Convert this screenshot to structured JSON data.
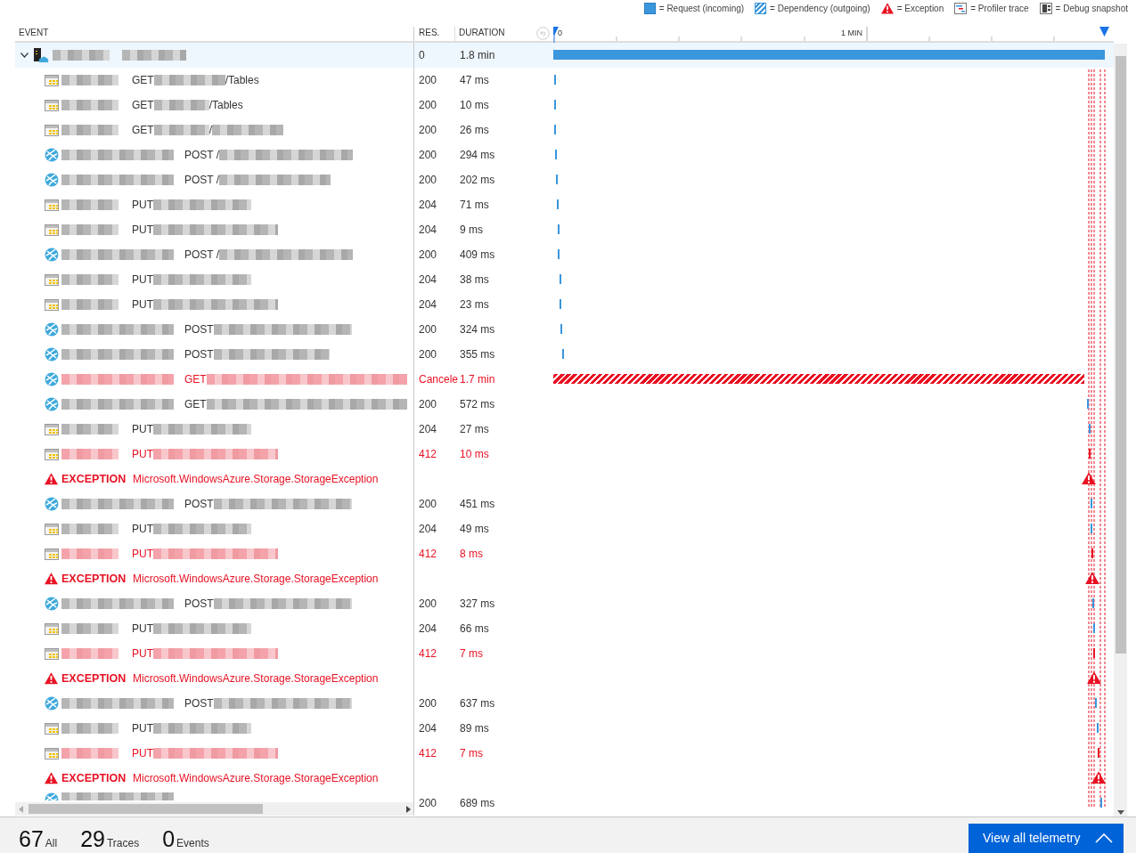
{
  "legend": [
    {
      "kind": "request",
      "label": "= Request (incoming)"
    },
    {
      "kind": "dependency",
      "label": "= Dependency (outgoing)"
    },
    {
      "kind": "exception",
      "label": "= Exception"
    },
    {
      "kind": "profiler",
      "label": "= Profiler trace"
    },
    {
      "kind": "snapshot",
      "label": "= Debug snapshot"
    }
  ],
  "columns": [
    "EVENT",
    "RES.",
    "DURATION"
  ],
  "timeline": {
    "start_label": "0",
    "mid_label": "1 MIN"
  },
  "rows": [
    {
      "kind": "root",
      "expanded": true,
      "selected": true,
      "res": "0",
      "duration": "1.8 min"
    },
    {
      "kind": "table",
      "selected": false,
      "failed": false,
      "method": "GET",
      "path": "/Tables",
      "res": "200",
      "duration": "47 ms"
    },
    {
      "kind": "table",
      "selected": false,
      "failed": false,
      "method": "GET",
      "path": "/Tables",
      "res": "200",
      "duration": "10 ms"
    },
    {
      "kind": "table",
      "selected": false,
      "failed": false,
      "method": "GET",
      "path": "/",
      "res": "200",
      "duration": "26 ms"
    },
    {
      "kind": "web",
      "selected": false,
      "failed": false,
      "method": "POST /",
      "res": "200",
      "duration": "294 ms"
    },
    {
      "kind": "web",
      "selected": false,
      "failed": false,
      "method": "POST /",
      "res": "200",
      "duration": "202 ms"
    },
    {
      "kind": "table",
      "selected": false,
      "failed": false,
      "method": "PUT",
      "res": "204",
      "duration": "71 ms"
    },
    {
      "kind": "table",
      "selected": false,
      "failed": false,
      "method": "PUT",
      "res": "204",
      "duration": "9 ms"
    },
    {
      "kind": "web",
      "selected": false,
      "failed": false,
      "method": "POST /",
      "res": "200",
      "duration": "409 ms"
    },
    {
      "kind": "table",
      "selected": false,
      "failed": false,
      "method": "PUT",
      "res": "204",
      "duration": "38 ms"
    },
    {
      "kind": "table",
      "selected": false,
      "failed": false,
      "method": "PUT",
      "res": "204",
      "duration": "23 ms"
    },
    {
      "kind": "web",
      "selected": false,
      "failed": false,
      "method": "POST",
      "res": "200",
      "duration": "324 ms"
    },
    {
      "kind": "web",
      "selected": false,
      "failed": false,
      "method": "POST",
      "res": "200",
      "duration": "355 ms"
    },
    {
      "kind": "web",
      "selected": false,
      "failed": true,
      "method": "GET",
      "res": "Cancele",
      "duration": "1.7 min",
      "level": 0.963
    },
    {
      "kind": "web",
      "selected": false,
      "failed": false,
      "method": "GET",
      "res": "200",
      "duration": "572 ms"
    },
    {
      "kind": "table",
      "selected": false,
      "failed": false,
      "method": "PUT",
      "res": "204",
      "duration": "27 ms"
    },
    {
      "kind": "table",
      "selected": false,
      "failed": true,
      "method": "PUT",
      "res": "412",
      "duration": "10 ms"
    },
    {
      "kind": "exception",
      "selected": false,
      "label": "EXCEPTION",
      "message": "Microsoft.WindowsAzure.Storage.StorageException"
    },
    {
      "kind": "web",
      "selected": false,
      "failed": false,
      "method": "POST",
      "res": "200",
      "duration": "451 ms"
    },
    {
      "kind": "table",
      "selected": false,
      "failed": false,
      "method": "PUT",
      "res": "204",
      "duration": "49 ms"
    },
    {
      "kind": "table",
      "selected": false,
      "failed": true,
      "method": "PUT",
      "res": "412",
      "duration": "8 ms"
    },
    {
      "kind": "exception",
      "selected": false,
      "label": "EXCEPTION",
      "message": "Microsoft.WindowsAzure.Storage.StorageException"
    },
    {
      "kind": "web",
      "selected": false,
      "failed": false,
      "method": "POST",
      "res": "200",
      "duration": "327 ms"
    },
    {
      "kind": "table",
      "selected": false,
      "failed": false,
      "method": "PUT",
      "res": "204",
      "duration": "66 ms"
    },
    {
      "kind": "table",
      "selected": false,
      "failed": true,
      "method": "PUT",
      "res": "412",
      "duration": "7 ms"
    },
    {
      "kind": "exception",
      "selected": false,
      "label": "EXCEPTION",
      "message": "Microsoft.WindowsAzure.Storage.StorageException"
    },
    {
      "kind": "web",
      "selected": false,
      "failed": false,
      "method": "POST",
      "res": "200",
      "duration": "637 ms"
    },
    {
      "kind": "table",
      "selected": false,
      "failed": false,
      "method": "PUT",
      "res": "204",
      "duration": "89 ms"
    },
    {
      "kind": "table",
      "selected": false,
      "failed": true,
      "method": "PUT",
      "res": "412",
      "duration": "7 ms"
    },
    {
      "kind": "exception",
      "selected": false,
      "label": "EXCEPTION",
      "message": "Microsoft.WindowsAzure.Storage.StorageException"
    },
    {
      "kind": "web",
      "selected": false,
      "failed": false,
      "res": "200",
      "duration": "689 ms"
    }
  ],
  "footer": {
    "counts": [
      {
        "value": "67",
        "label": "All"
      },
      {
        "value": "29",
        "label": "Traces"
      },
      {
        "value": "0",
        "label": "Events"
      }
    ],
    "button": "View all telemetry"
  }
}
